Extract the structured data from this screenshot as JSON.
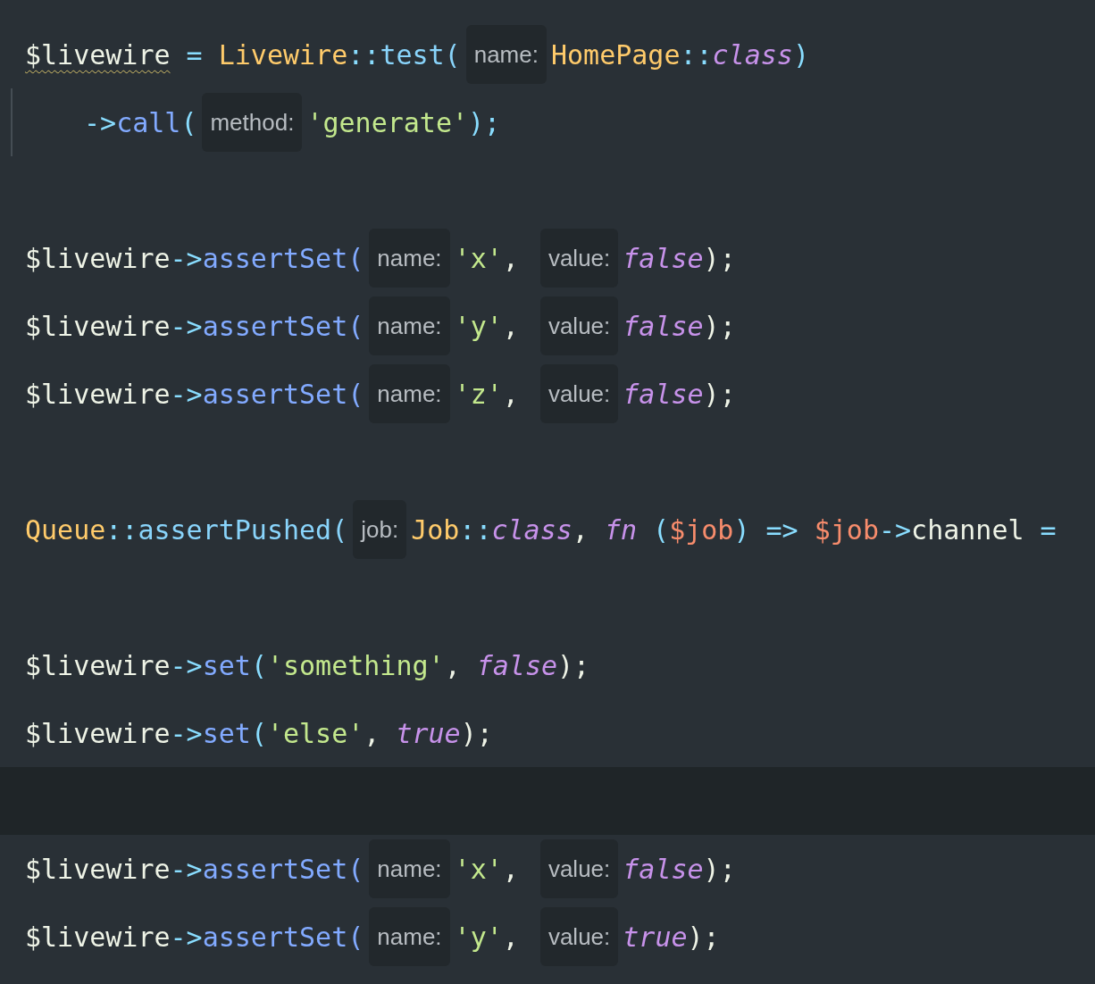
{
  "editor": {
    "lines": [
      {
        "kind": "code",
        "tokens": [
          {
            "kind": "variable_warning",
            "text": "$livewire"
          },
          {
            "kind": "operator",
            "text": " = "
          },
          {
            "kind": "class",
            "text": "Livewire"
          },
          {
            "kind": "operator",
            "text": "::"
          },
          {
            "kind": "function",
            "text": "test("
          },
          {
            "kind": "hint",
            "text": "name:"
          },
          {
            "kind": "class",
            "text": "HomePage"
          },
          {
            "kind": "operator",
            "text": "::"
          },
          {
            "kind": "keyword",
            "text": "class"
          },
          {
            "kind": "operator",
            "text": ")"
          }
        ]
      },
      {
        "kind": "indented_code",
        "tokens": [
          {
            "kind": "operator",
            "text": "->"
          },
          {
            "kind": "method",
            "text": "call"
          },
          {
            "kind": "operator",
            "text": "("
          },
          {
            "kind": "hint",
            "text": "method:"
          },
          {
            "kind": "string",
            "text": "'generate'"
          },
          {
            "kind": "operator",
            "text": ");"
          }
        ]
      },
      {
        "kind": "blank"
      },
      {
        "kind": "code",
        "tokens": [
          {
            "kind": "variable",
            "text": "$livewire"
          },
          {
            "kind": "operator",
            "text": "->"
          },
          {
            "kind": "method",
            "text": "assertSet("
          },
          {
            "kind": "hint",
            "text": "name:"
          },
          {
            "kind": "string",
            "text": "'x'"
          },
          {
            "kind": "plain",
            "text": ", "
          },
          {
            "kind": "hint",
            "text": "value:"
          },
          {
            "kind": "keyword",
            "text": "false"
          },
          {
            "kind": "plain",
            "text": ");"
          }
        ]
      },
      {
        "kind": "code",
        "tokens": [
          {
            "kind": "variable",
            "text": "$livewire"
          },
          {
            "kind": "operator",
            "text": "->"
          },
          {
            "kind": "method",
            "text": "assertSet("
          },
          {
            "kind": "hint",
            "text": "name:"
          },
          {
            "kind": "string",
            "text": "'y'"
          },
          {
            "kind": "plain",
            "text": ", "
          },
          {
            "kind": "hint",
            "text": "value:"
          },
          {
            "kind": "keyword",
            "text": "false"
          },
          {
            "kind": "plain",
            "text": ");"
          }
        ]
      },
      {
        "kind": "code",
        "tokens": [
          {
            "kind": "variable",
            "text": "$livewire"
          },
          {
            "kind": "operator",
            "text": "->"
          },
          {
            "kind": "method",
            "text": "assertSet("
          },
          {
            "kind": "hint",
            "text": "name:"
          },
          {
            "kind": "string",
            "text": "'z'"
          },
          {
            "kind": "plain",
            "text": ", "
          },
          {
            "kind": "hint",
            "text": "value:"
          },
          {
            "kind": "keyword",
            "text": "false"
          },
          {
            "kind": "plain",
            "text": ");"
          }
        ]
      },
      {
        "kind": "blank"
      },
      {
        "kind": "code",
        "tokens": [
          {
            "kind": "class",
            "text": "Queue"
          },
          {
            "kind": "operator",
            "text": "::"
          },
          {
            "kind": "function",
            "text": "assertPushed("
          },
          {
            "kind": "hint",
            "text": "job:"
          },
          {
            "kind": "class",
            "text": "Job"
          },
          {
            "kind": "operator",
            "text": "::"
          },
          {
            "kind": "keyword",
            "text": "class"
          },
          {
            "kind": "plain",
            "text": ", "
          },
          {
            "kind": "keyword",
            "text": "fn"
          },
          {
            "kind": "operator",
            "text": " ("
          },
          {
            "kind": "param",
            "text": "$job"
          },
          {
            "kind": "operator",
            "text": ") => "
          },
          {
            "kind": "param",
            "text": "$job"
          },
          {
            "kind": "operator",
            "text": "->"
          },
          {
            "kind": "plain",
            "text": "channel"
          },
          {
            "kind": "operator",
            "text": " ="
          }
        ]
      },
      {
        "kind": "blank"
      },
      {
        "kind": "code",
        "tokens": [
          {
            "kind": "variable",
            "text": "$livewire"
          },
          {
            "kind": "operator",
            "text": "->"
          },
          {
            "kind": "method",
            "text": "set"
          },
          {
            "kind": "operator",
            "text": "("
          },
          {
            "kind": "string",
            "text": "'something'"
          },
          {
            "kind": "plain",
            "text": ", "
          },
          {
            "kind": "keyword",
            "text": "false"
          },
          {
            "kind": "plain",
            "text": ");"
          }
        ]
      },
      {
        "kind": "code",
        "tokens": [
          {
            "kind": "variable",
            "text": "$livewire"
          },
          {
            "kind": "operator",
            "text": "->"
          },
          {
            "kind": "method",
            "text": "set"
          },
          {
            "kind": "operator",
            "text": "("
          },
          {
            "kind": "string",
            "text": "'else'"
          },
          {
            "kind": "plain",
            "text": ", "
          },
          {
            "kind": "keyword",
            "text": "true"
          },
          {
            "kind": "plain",
            "text": ");"
          }
        ]
      },
      {
        "kind": "current_blank"
      },
      {
        "kind": "code",
        "tokens": [
          {
            "kind": "variable",
            "text": "$livewire"
          },
          {
            "kind": "operator",
            "text": "->"
          },
          {
            "kind": "method",
            "text": "assertSet("
          },
          {
            "kind": "hint",
            "text": "name:"
          },
          {
            "kind": "string",
            "text": "'x'"
          },
          {
            "kind": "plain",
            "text": ", "
          },
          {
            "kind": "hint",
            "text": "value:"
          },
          {
            "kind": "keyword",
            "text": "false"
          },
          {
            "kind": "plain",
            "text": ");"
          }
        ]
      },
      {
        "kind": "code",
        "tokens": [
          {
            "kind": "variable",
            "text": "$livewire"
          },
          {
            "kind": "operator",
            "text": "->"
          },
          {
            "kind": "method",
            "text": "assertSet("
          },
          {
            "kind": "hint",
            "text": "name:"
          },
          {
            "kind": "string",
            "text": "'y'"
          },
          {
            "kind": "plain",
            "text": ", "
          },
          {
            "kind": "hint",
            "text": "value:"
          },
          {
            "kind": "keyword",
            "text": "true"
          },
          {
            "kind": "plain",
            "text": ");"
          }
        ]
      }
    ]
  }
}
